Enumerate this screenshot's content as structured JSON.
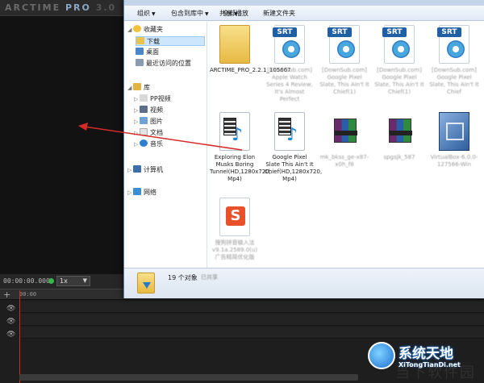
{
  "arctime": {
    "logo_main": "ARCTIME",
    "logo_pro": "PRO",
    "logo_ver": "3.0",
    "timecode": "00:00:00.000",
    "speed": "1x",
    "ruler_timecode": "00:00"
  },
  "explorer": {
    "toolbar": {
      "organize": "组织",
      "include_in_library": "包含到库中",
      "share": "共享",
      "slideshow": "全部播放",
      "new_folder": "新建文件夹"
    },
    "nav": {
      "favorites": "收藏夹",
      "downloads": "下载",
      "desktop": "桌面",
      "recent": "最近访问的位置",
      "library": "库",
      "pp_video": "PP视频",
      "videos": "视频",
      "pictures": "图片",
      "documents": "文档",
      "music": "音乐",
      "computer": "计算机",
      "network": "网络"
    },
    "files": [
      {
        "name": "ARCTIME_PRO_2.2.1_105667",
        "type": "folder"
      },
      {
        "name": "[DownSub.com] Apple Watch Series 4 Review, It's Almost Perfect",
        "type": "srt"
      },
      {
        "name": "[DownSub.com] Google Pixel Slate, This Ain't It Chief(1)",
        "type": "srt"
      },
      {
        "name": "[DownSub.com] Google Pixel Slate, This Ain't It Chief(1)",
        "type": "srt"
      },
      {
        "name": "[DownSub.com] Google Pixel Slate, This Ain't It Chief",
        "type": "srt"
      },
      {
        "name": "Exploring Elon Musks Boring Tunnel(HD,1280x720, Mp4)",
        "type": "media"
      },
      {
        "name": "Google Pixel Slate This Ain't It Chief(HD,1280x720, Mp4)",
        "type": "media"
      },
      {
        "name": "mk_bkss_ge-x87-x0h_f8",
        "type": "rar"
      },
      {
        "name": "spgsjk_587",
        "type": "rar"
      },
      {
        "name": "VirtualBox-6.0.0-127566-Win",
        "type": "vbox"
      },
      {
        "name": "搜狗拼音输入法v9.1a.2589.0(u)广告精简优化版",
        "type": "setup"
      }
    ],
    "status": {
      "count": "19 个对象",
      "state": "已共享"
    }
  },
  "watermark": {
    "title": "系统天地",
    "subtitle": "XiTongTianDi.net",
    "faint": "当下软件园"
  },
  "colors": {
    "arrow": "#d62a2a",
    "playhead": "#dd2222",
    "accent": "#1f5fa3"
  }
}
